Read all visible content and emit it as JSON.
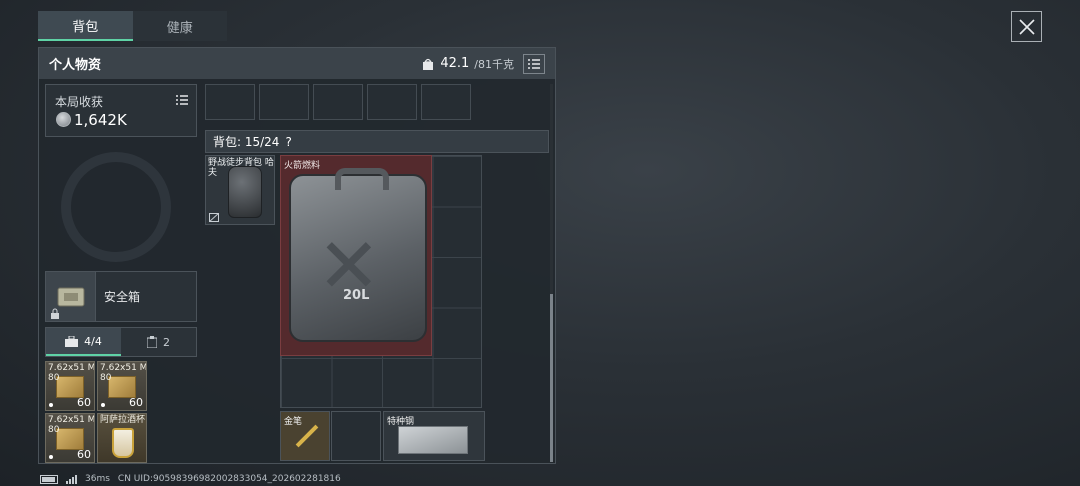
{
  "tabs": [
    {
      "label": "背包",
      "active": true
    },
    {
      "label": "健康",
      "active": false
    }
  ],
  "panel": {
    "title": "个人物资",
    "weight_current": "42.1",
    "weight_max": "/81千克"
  },
  "harvest": {
    "label": "本局收获",
    "value": "1,642K"
  },
  "safebox": {
    "label": "安全箱"
  },
  "subtabs": [
    {
      "label": "4/4",
      "icon": "toolbox-icon",
      "active": true
    },
    {
      "label": "2",
      "icon": "clipboard-icon",
      "active": false
    }
  ],
  "ammo_items": [
    {
      "name": "7.62x51 M80",
      "count": "60",
      "kind": "ammo-box"
    },
    {
      "name": "7.62x51 M80",
      "count": "60",
      "kind": "ammo-box"
    },
    {
      "name": "7.62x51 M80",
      "count": "60",
      "kind": "ammo-box"
    },
    {
      "name": "阿萨拉酒杯",
      "count": "",
      "kind": "goblet"
    }
  ],
  "backpack": {
    "label": "背包: 15/24",
    "help": "?"
  },
  "bag_items": {
    "backpack_name": "野战徒步背包 哈夫",
    "fuel_name": "火箭燃料",
    "fuel_text": "20L",
    "pen_name": "金笔",
    "steel_name": "特种钢"
  },
  "footer": {
    "ping": "36ms",
    "uid": "CN UID:9059839698200283305‌4_202602281816"
  },
  "colors": {
    "accent": "#5fd3a6",
    "fuel_bg": "#542a2d"
  }
}
